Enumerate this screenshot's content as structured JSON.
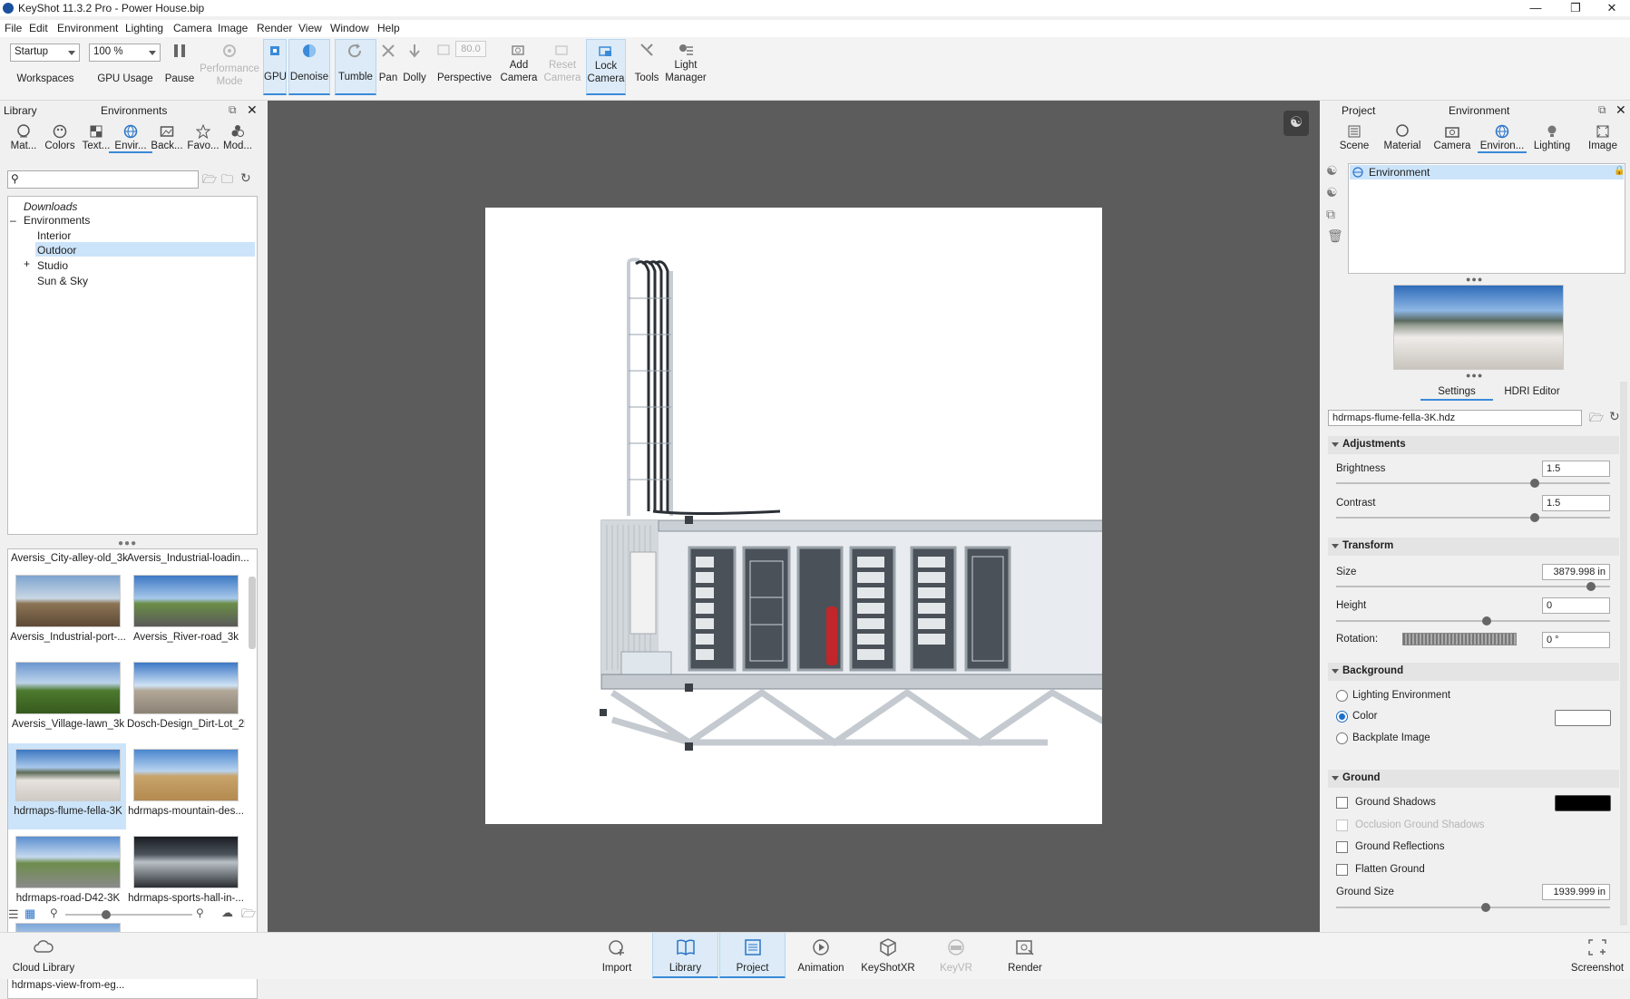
{
  "window": {
    "title": "KeyShot 11.3.2 Pro - Power House.bip"
  },
  "menu": [
    "File",
    "Edit",
    "Environment",
    "Lighting",
    "Camera",
    "Image",
    "Render",
    "View",
    "Window",
    "Help"
  ],
  "toolbar": {
    "workspace_value": "Startup",
    "workspaces_label": "Workspaces",
    "gpu_usage_value": "100 %",
    "gpu_usage_label": "GPU Usage",
    "pause": "Pause",
    "performance_mode": "Performance Mode",
    "gpu": "GPU",
    "denoise": "Denoise",
    "tumble": "Tumble",
    "pan": "Pan",
    "dolly": "Dolly",
    "fov_value": "80.0",
    "perspective": "Perspective",
    "add_camera": "Add Camera",
    "reset_camera": "Reset Camera",
    "lock_camera": "Lock Camera",
    "tools": "Tools",
    "light_manager": "Light Manager"
  },
  "library": {
    "title": "Library",
    "panel": "Environments",
    "tabs": [
      "Mat...",
      "Colors",
      "Text...",
      "Envir...",
      "Back...",
      "Favo...",
      "Mod..."
    ],
    "search_value": "",
    "tree": [
      {
        "label": "Downloads",
        "italic": true
      },
      {
        "label": "Environments"
      },
      {
        "label": "Interior"
      },
      {
        "label": "Outdoor",
        "selected": true
      },
      {
        "label": "Studio"
      },
      {
        "label": "Sun & Sky"
      }
    ],
    "thumb_top_labels": [
      "Aversis_City-alley-old_3k",
      "Aversis_Industrial-loadin..."
    ],
    "thumbs": [
      {
        "label": "Aversis_Industrial-port-..."
      },
      {
        "label": "Aversis_River-road_3k"
      },
      {
        "label": "Aversis_Village-lawn_3k"
      },
      {
        "label": "Dosch-Design_Dirt-Lot_2k"
      },
      {
        "label": "hdrmaps-flume-fella-3K",
        "selected": true
      },
      {
        "label": "hdrmaps-mountain-des..."
      },
      {
        "label": "hdrmaps-road-D42-3K"
      },
      {
        "label": "hdrmaps-sports-hall-in-..."
      },
      {
        "label": "hdrmaps-view-from-eg..."
      }
    ]
  },
  "project": {
    "title": "Project",
    "panel": "Environment",
    "tabs": [
      "Scene",
      "Material",
      "Camera",
      "Environ...",
      "Lighting",
      "Image"
    ],
    "env_list": [
      "Environment"
    ],
    "subtabs": [
      "Settings",
      "HDRI Editor"
    ],
    "hdri_file": "hdrmaps-flume-fella-3K.hdz",
    "adjustments": {
      "title": "Adjustments",
      "brightness_label": "Brightness",
      "brightness": "1.5",
      "contrast_label": "Contrast",
      "contrast": "1.5"
    },
    "transform": {
      "title": "Transform",
      "size_label": "Size",
      "size": "3879.998 in",
      "height_label": "Height",
      "height": "0",
      "rotation_label": "Rotation:",
      "rotation": "0 °"
    },
    "background": {
      "title": "Background",
      "options": [
        "Lighting Environment",
        "Color",
        "Backplate Image"
      ],
      "selected": "Color",
      "color": "#ffffff"
    },
    "ground": {
      "title": "Ground",
      "shadows": "Ground Shadows",
      "shadow_color": "#000000",
      "occlusion": "Occlusion Ground Shadows",
      "reflections": "Ground Reflections",
      "flatten": "Flatten Ground",
      "size_label": "Ground Size",
      "size": "1939.999 in"
    }
  },
  "bottom": {
    "cloud_library": "Cloud Library",
    "buttons": [
      "Import",
      "Library",
      "Project",
      "Animation",
      "KeyShotXR",
      "KeyVR",
      "Render"
    ],
    "screenshot": "Screenshot"
  }
}
